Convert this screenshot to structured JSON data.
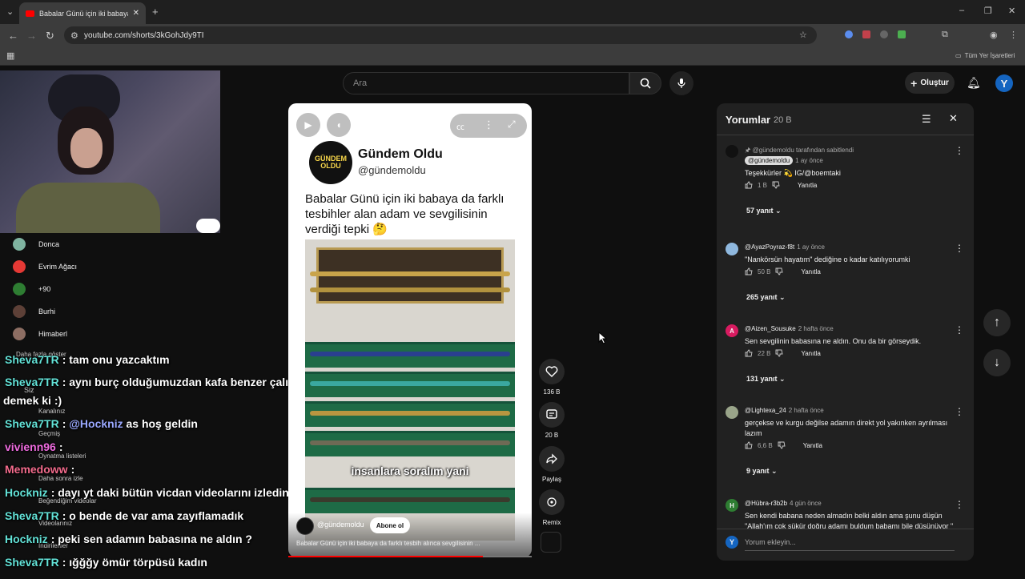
{
  "browser": {
    "tab_title": "Babalar Günü için iki babaya da farklı tesbih",
    "url": "youtube.com/shorts/3kGohJdy9TI",
    "bookmarks_label": "Tüm Yer İşaretleri"
  },
  "header": {
    "search_placeholder": "Ara",
    "create_label": "Oluştur",
    "avatar_letter": "Y"
  },
  "sidebar": {
    "subs": [
      {
        "label": "Donca",
        "color": "#7fb3a0"
      },
      {
        "label": "Evrim Ağacı",
        "color": "#e53935"
      },
      {
        "label": "+90",
        "color": "#2e7d32"
      },
      {
        "label": "Burhi",
        "color": "#5d4037"
      },
      {
        "label": "Himaberl",
        "color": "#8d6e63"
      }
    ],
    "more_label": "Daha fazla göster",
    "you_label": "Siz",
    "links": [
      "Kanalınız",
      "Geçmiş",
      "Oynatma listeleri",
      "Daha sonra izle",
      "Beğendiğim videolar",
      "Videolarınız",
      "İndirilenler"
    ]
  },
  "chat": [
    {
      "user": "Sheva7TR",
      "color": "#63e3d8",
      "msg": ": tam onu yazcaktım"
    },
    {
      "user": "Sheva7TR",
      "color": "#63e3d8",
      "msg": ": aynı burç olduğumuzdan kafa benzer çalışıyor"
    },
    {
      "user": "",
      "color": "#ffffff",
      "msg": "demek ki :)"
    },
    {
      "user": "Sheva7TR",
      "color": "#63e3d8",
      "msg": ":"
    },
    {
      "user": "vivienn96",
      "color": "#f06ce0",
      "msg": ":"
    },
    {
      "user": "Memedoww",
      "color": "#f36b8c",
      "msg": ":"
    },
    {
      "user": "Hockniz",
      "color": "#63e3d8",
      "msg": ": dayı yt daki bütün vicdan videolarını izledin he"
    },
    {
      "user": "Sheva7TR",
      "color": "#63e3d8",
      "msg": ": o bende de var ama zayıflamadık"
    },
    {
      "user": "Hockniz",
      "color": "#63e3d8",
      "msg": ": peki sen adamın babasına ne aldın ?"
    },
    {
      "user": "Sheva7TR",
      "color": "#63e3d8",
      "msg": ": ığğğy ömür törpüsü kadın"
    }
  ],
  "chat_mention": {
    "mention": "@Hockniz",
    "rest": "as hoş geldin",
    "mention_color": "#9aa8ff"
  },
  "video": {
    "logo_text": "GÜNDEM OLDU",
    "title": "Gündem Oldu",
    "handle": "@gündemoldu",
    "post_text": "Babalar Günü için iki babaya da farklı tesbihler alan adam ve sevgilisinin verdiği tepki 🤔",
    "caption": "insanlara soralım yani",
    "channel": "@gündemoldu",
    "subscribe_label": "Abone ol",
    "description": "Babalar Günü için iki babaya da farklı tesbih alınca sevgilisinin ...",
    "progress": 0.8
  },
  "actions": {
    "likes": "136 B",
    "comments": "20 B",
    "share": "Paylaş",
    "remix": "Remix"
  },
  "comments": {
    "title": "Yorumlar",
    "count": "20 B",
    "input_placeholder": "Yorum ekleyin...",
    "pinned_by": "@gündemoldu tarafından sabitlendi",
    "items": [
      {
        "user": "@gündemoldu",
        "time": "1 ay önce",
        "text": "Teşekkürler 💫 IG/@boemtaki",
        "likes": "1 B",
        "replies": "57 yanıt",
        "avatar": "",
        "avatar_color": "#111111"
      },
      {
        "user": "@AyazPoyraz-f8t",
        "time": "1 ay önce",
        "text": "\"Nankörsün hayatım\" dediğine o kadar katılıyorumki",
        "likes": "50 B",
        "replies": "265 yanıt",
        "avatar": "",
        "avatar_color": "#8fb8de"
      },
      {
        "user": "@Aizen_Sousuke",
        "time": "2 hafta önce",
        "text": "Sen sevgilinin babasına ne aldın. Onu da bir görseydik.",
        "likes": "22 B",
        "replies": "131 yanıt",
        "avatar": "A",
        "avatar_color": "#d81b60"
      },
      {
        "user": "@Lightexa_24",
        "time": "2 hafta önce",
        "text": "gerçekse ve kurgu değilse adamın direkt yol yakınken ayrılması lazım",
        "likes": "6,6 B",
        "replies": "9 yanıt",
        "avatar": "",
        "avatar_color": "#9aa58a"
      },
      {
        "user": "@Hübra-r3b2b",
        "time": "4 gün önce",
        "text": "Sen kendi babana neden almadın belki aldın ama şunu düşün \"Allah'ım çok şükür doğru adamı buldum babamı bile düşünüyor \"",
        "likes": "",
        "replies": "",
        "avatar": "H",
        "avatar_color": "#2e7d32"
      }
    ],
    "reply_label": "Yanıtla"
  }
}
